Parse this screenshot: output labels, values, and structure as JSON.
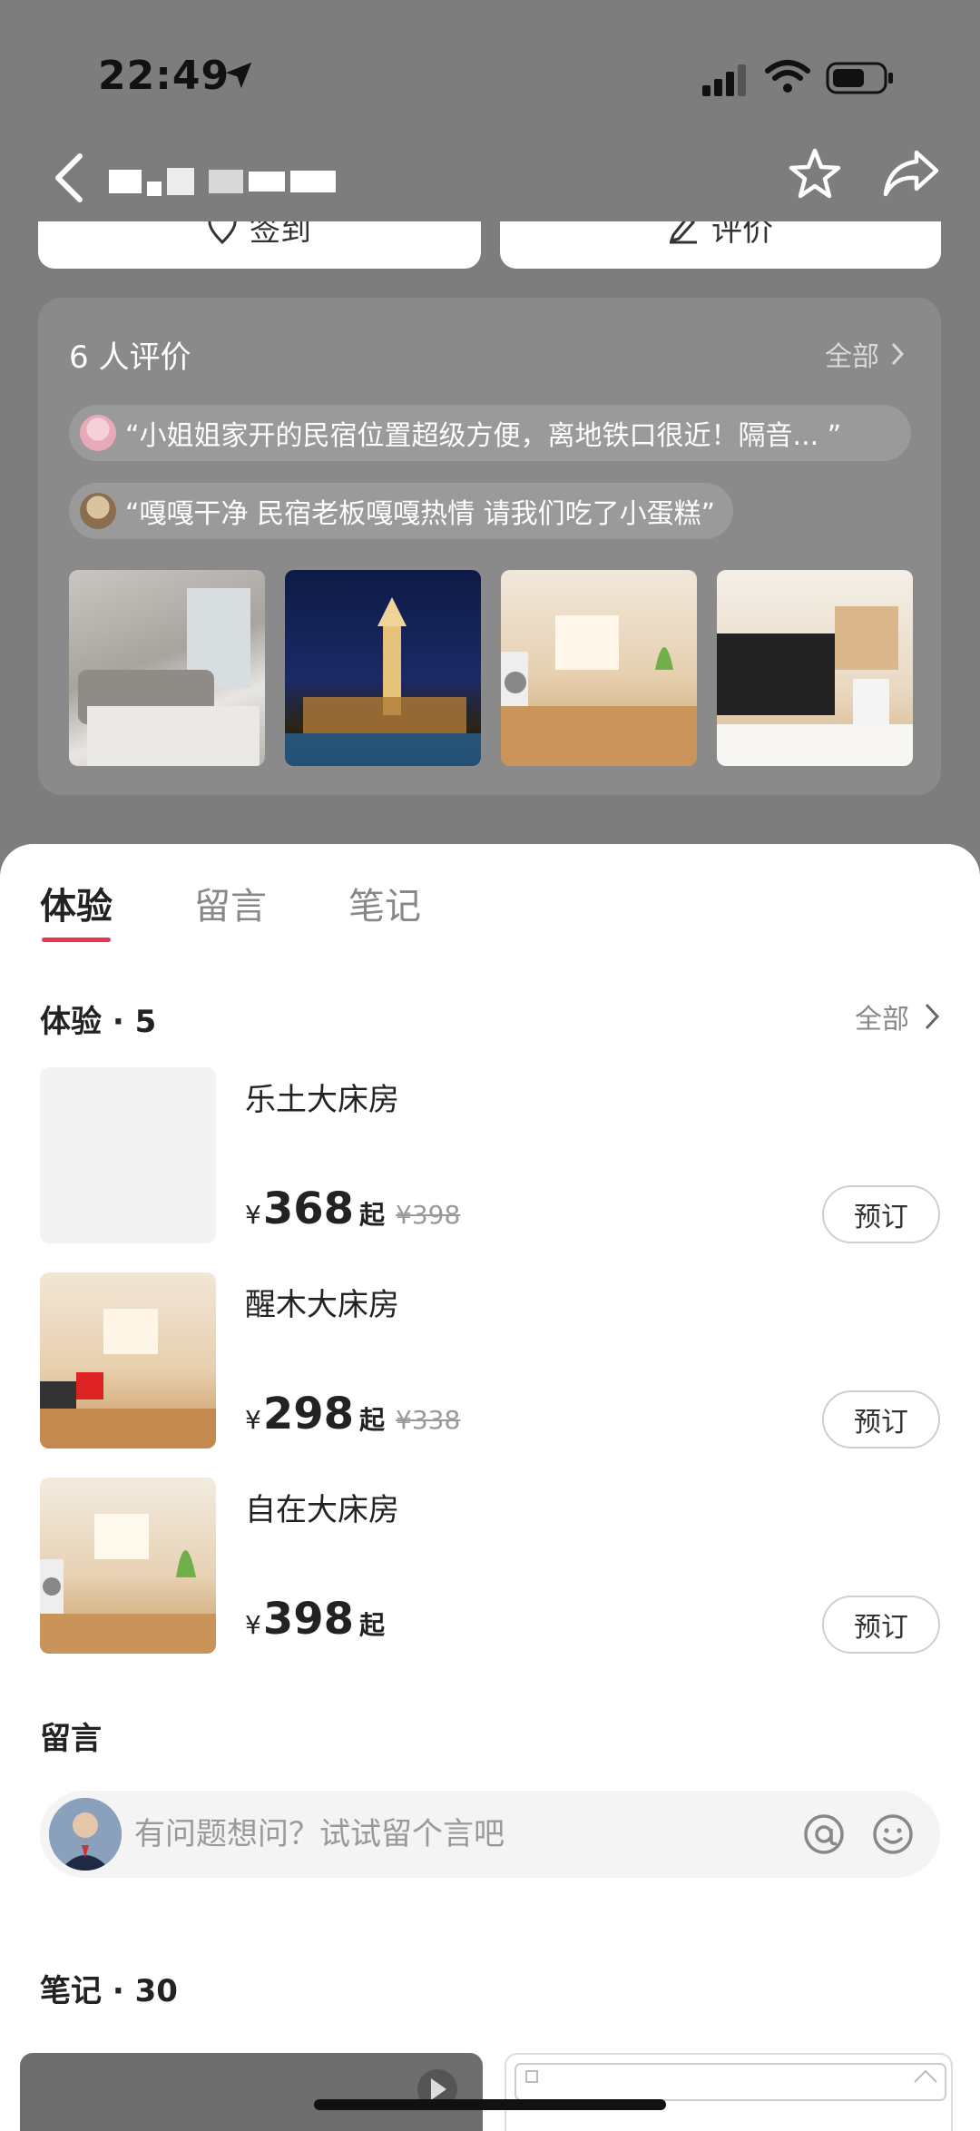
{
  "status_bar": {
    "time": "22:49"
  },
  "nav": {
    "title_obscured": true
  },
  "top_actions": {
    "checkin_label": "签到",
    "review_label": "评价"
  },
  "reviews": {
    "title": "6 人评价",
    "all_label": "全部",
    "quotes": [
      "“小姐姐家开的民宿位置超级方便，离地铁口很近！隔音... ”",
      "“嘎嘎干净 民宿老板嘎嘎热情 请我们吃了小蛋糕”"
    ]
  },
  "tabs": [
    "体验",
    "留言",
    "笔记"
  ],
  "experience": {
    "title": "体验 · 5",
    "all_label": "全部",
    "rooms": [
      {
        "name": "乐土大床房",
        "currency": "¥",
        "price": "368",
        "suffix": "起",
        "original": "¥398",
        "book": "预订"
      },
      {
        "name": "醒木大床房",
        "currency": "¥",
        "price": "298",
        "suffix": "起",
        "original": "¥338",
        "book": "预订"
      },
      {
        "name": "自在大床房",
        "currency": "¥",
        "price": "398",
        "suffix": "起",
        "original": "",
        "book": "预订"
      }
    ]
  },
  "message": {
    "title": "留言",
    "placeholder": "有问题想问？试试留个言吧"
  },
  "notes": {
    "title": "笔记 · 30"
  },
  "colors": {
    "accent": "#e8344e",
    "overlay": "#7d7d7d"
  }
}
